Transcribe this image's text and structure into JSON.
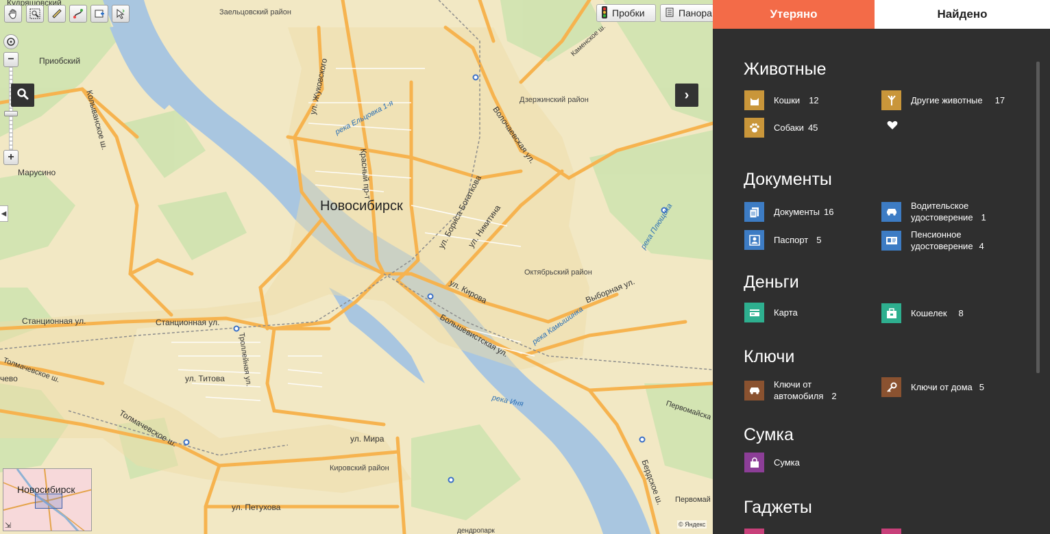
{
  "map": {
    "toolbar": {
      "tools": [
        "hand-icon",
        "zoom-area-icon",
        "ruler-icon",
        "route-icon",
        "add-object-icon",
        "select-icon"
      ]
    },
    "top_buttons": {
      "traffic": "Пробки",
      "panorama": "Панора"
    },
    "city_label": "Новосибирск",
    "districts": {
      "zaeltsovsky": "Заельцовский район",
      "dzerzhinsky": "Дзержинский район",
      "oktyabrsky": "Октябрьский район",
      "kirovsky": "Кировский район"
    },
    "places": {
      "kudryashovsky": "Кудряшовский",
      "priobsky": "Приобский",
      "marusino": "Марусино",
      "tolmachevo": "чево"
    },
    "streets": {
      "zhukovskogo": "ул. Жуковского",
      "krasny": "Красный пр-т",
      "bogatkova": "ул. Бориса Богаткова",
      "nikitina": "ул. Никитина",
      "volochaevskaya": "Волочаевская ул.",
      "kamenskoe": "Каменское ш.",
      "kolyvanskoe": "Колыванское ш.",
      "stantsionnaya_left": "Станционная ул.",
      "stantsionnaya": "Станционная ул.",
      "titova": "ул. Титова",
      "trolleynaya": "Троллейная ул.",
      "kirova": "ул. Кирова",
      "bolshevistskaya": "Большевистская ул.",
      "vybornaya": "Выборная ул.",
      "tolmachevskoe": "Толмачевское ш.",
      "tolmachevskoe2": "Толмачевское ш.",
      "mira": "ул. Мира",
      "petukhova": "ул. Петухова",
      "berdskoe": "Бердское ш.",
      "pervomayskaya": "Первомайска",
      "pervomay2": "Первомай",
      "dendropark": "дендропарк"
    },
    "rivers": {
      "eltsovka": "река Ельцовка 1-я",
      "plyushchikha": "река Плющиха",
      "kamyshinka": "река Камышинка",
      "inya": "река Иня"
    },
    "minimap_title": "Новосибирск",
    "copyright": "© Яндекс"
  },
  "panel": {
    "tabs": {
      "lost": "Утеряно",
      "found": "Найдено"
    },
    "sections": [
      {
        "title": "Животные",
        "items": [
          {
            "label": "Кошки",
            "count": "12",
            "icon": "cat-icon",
            "color": "#c9963a"
          },
          {
            "label": "Другие животные",
            "count": "17",
            "icon": "other-animals-icon",
            "color": "#c9963a"
          },
          {
            "label": "Собаки",
            "count": "45",
            "icon": "paw-icon",
            "color": "#c9963a"
          }
        ]
      },
      {
        "title": "Документы",
        "items": [
          {
            "label": "Документы",
            "count": "16",
            "icon": "documents-icon",
            "color": "#3d7cc4"
          },
          {
            "label": "Водительское удостоверение",
            "line1": "Водительское",
            "line2": "удостоверение",
            "count": "1",
            "icon": "car-license-icon",
            "color": "#3d7cc4"
          },
          {
            "label": "Паспорт",
            "count": "5",
            "icon": "passport-icon",
            "color": "#3d7cc4"
          },
          {
            "label": "Пенсионное удостоверение",
            "line1": "Пенсионное",
            "line2": "удостоверение",
            "count": "4",
            "icon": "pension-card-icon",
            "color": "#3d7cc4"
          }
        ]
      },
      {
        "title": "Деньги",
        "items": [
          {
            "label": "Карта",
            "count": "",
            "icon": "card-icon",
            "color": "#2eaf8f"
          },
          {
            "label": "Кошелек",
            "count": "8",
            "icon": "wallet-icon",
            "color": "#2eaf8f"
          }
        ]
      },
      {
        "title": "Ключи",
        "items": [
          {
            "label": "Ключи от автомобиля",
            "line1": "Ключи от",
            "line2": "автомобиля",
            "count": "2",
            "icon": "car-keys-icon",
            "color": "#8a5230"
          },
          {
            "label": "Ключи от дома",
            "count": "5",
            "icon": "house-key-icon",
            "color": "#8a5230"
          }
        ]
      },
      {
        "title": "Сумка",
        "items": [
          {
            "label": "Сумка",
            "count": "",
            "icon": "bag-icon",
            "color": "#8c3e97"
          }
        ]
      },
      {
        "title": "Гаджеты",
        "items": []
      }
    ],
    "colors": {
      "lost_tab": "#f36b48",
      "panel_bg": "#2f2f2f"
    }
  }
}
